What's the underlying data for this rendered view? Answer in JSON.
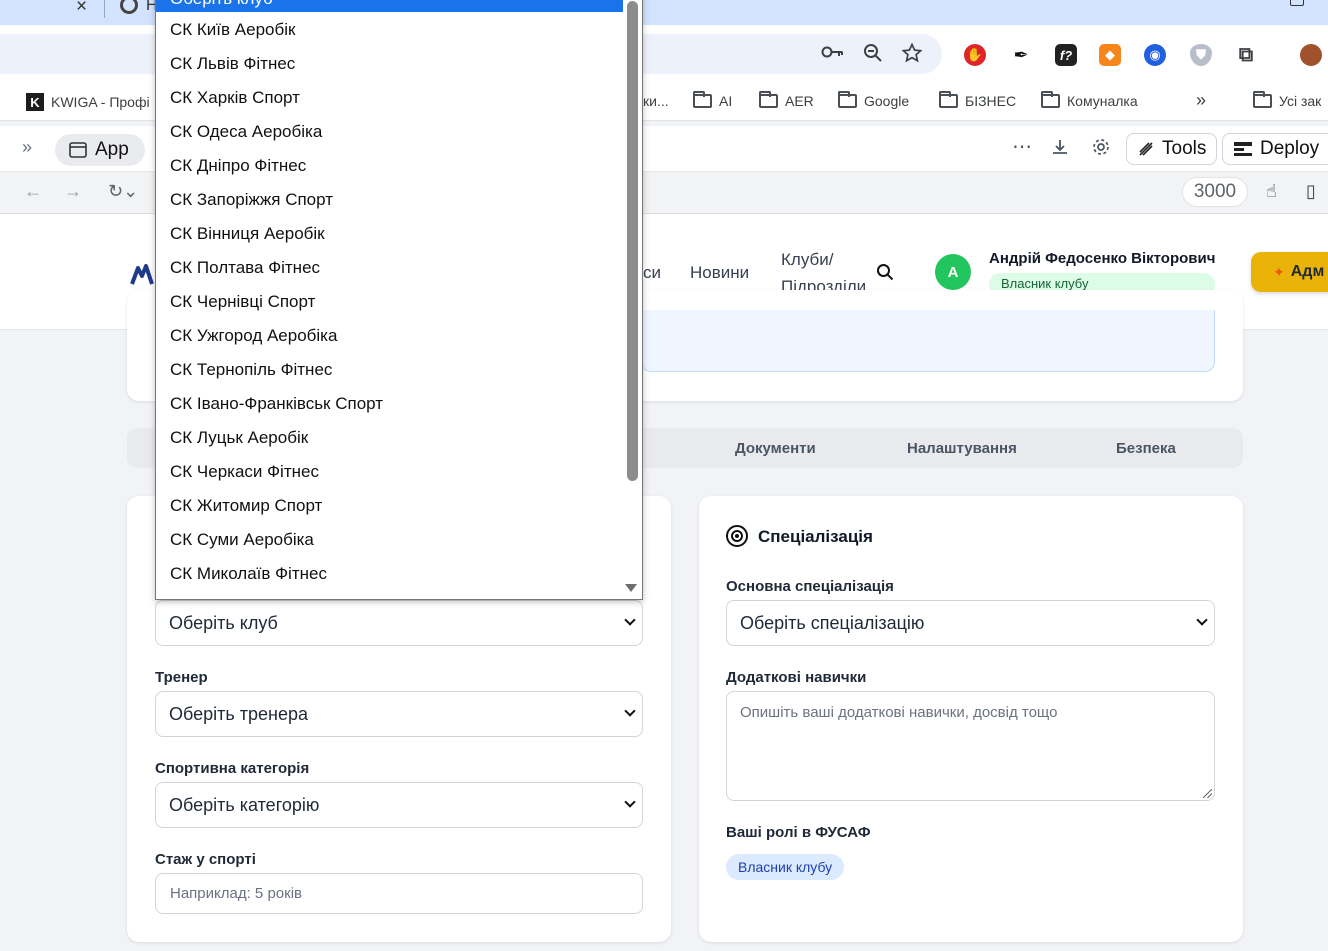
{
  "browser": {
    "tab_partial_title": "Н",
    "bookmarks": [
      {
        "label": "KWIGA - Профі",
        "type": "site"
      },
      {
        "label": "ки...",
        "type": "partial"
      },
      {
        "label": "AI",
        "type": "folder"
      },
      {
        "label": "AER",
        "type": "folder"
      },
      {
        "label": "Google",
        "type": "folder"
      },
      {
        "label": "БІЗНЕС",
        "type": "folder"
      },
      {
        "label": "Комуналка",
        "type": "folder"
      },
      {
        "label": "Усі зак",
        "type": "folder"
      }
    ],
    "bookmarks_overflow": "»"
  },
  "devbar": {
    "app_label": "App",
    "tools_label": "Tools",
    "deploy_label": "Deploy",
    "port": "3000"
  },
  "header": {
    "nav_partial": "си",
    "nav_news": "Новини",
    "nav_clubs_line1": "Клуби/",
    "nav_clubs_line2": "Підрозділи",
    "avatar_letter": "А",
    "user_name": "Андрій Федосенко Вікторович",
    "user_role": "Власник клубу",
    "admin_label": "Адм"
  },
  "tabs": [
    "Документи",
    "Налаштування",
    "Безпека"
  ],
  "left_card": {
    "club_select_value": "Оберіть клуб",
    "trainer_label": "Тренер",
    "trainer_value": "Оберіть тренера",
    "category_label": "Спортивна категорія",
    "category_value": "Оберіть категорію",
    "experience_label": "Стаж у спорті",
    "experience_placeholder": "Наприклад: 5 років"
  },
  "right_card": {
    "title": "Спеціалізація",
    "main_spec_label": "Основна спеціалізація",
    "main_spec_value": "Оберіть спеціалізацію",
    "skills_label": "Додаткові навички",
    "skills_placeholder": "Опишіть ваші додаткові навички, досвід тощо",
    "roles_label": "Ваші ролі в ФУСАФ",
    "role_chip": "Власник клубу"
  },
  "club_dropdown": {
    "selected": "Оберіть клуб",
    "options": [
      "СК Київ Аеробік",
      "СК Львів Фітнес",
      "СК Харків Спорт",
      "СК Одеса Аеробіка",
      "СК Дніпро Фітнес",
      "СК Запоріжжя Спорт",
      "СК Вінниця Аеробік",
      "СК Полтава Фітнес",
      "СК Чернівці Спорт",
      "СК Ужгород Аеробіка",
      "СК Тернопіль Фітнес",
      "СК Івано-Франківськ Спорт",
      "СК Луцьк Аеробік",
      "СК Черкаси Фітнес",
      "СК Житомир Спорт",
      "СК Суми Аеробіка",
      "СК Миколаїв Фітнес"
    ]
  },
  "colors": {
    "accent_blue": "#1a73e8",
    "avatar_green": "#22c55e",
    "admin_yellow": "#eab308"
  }
}
